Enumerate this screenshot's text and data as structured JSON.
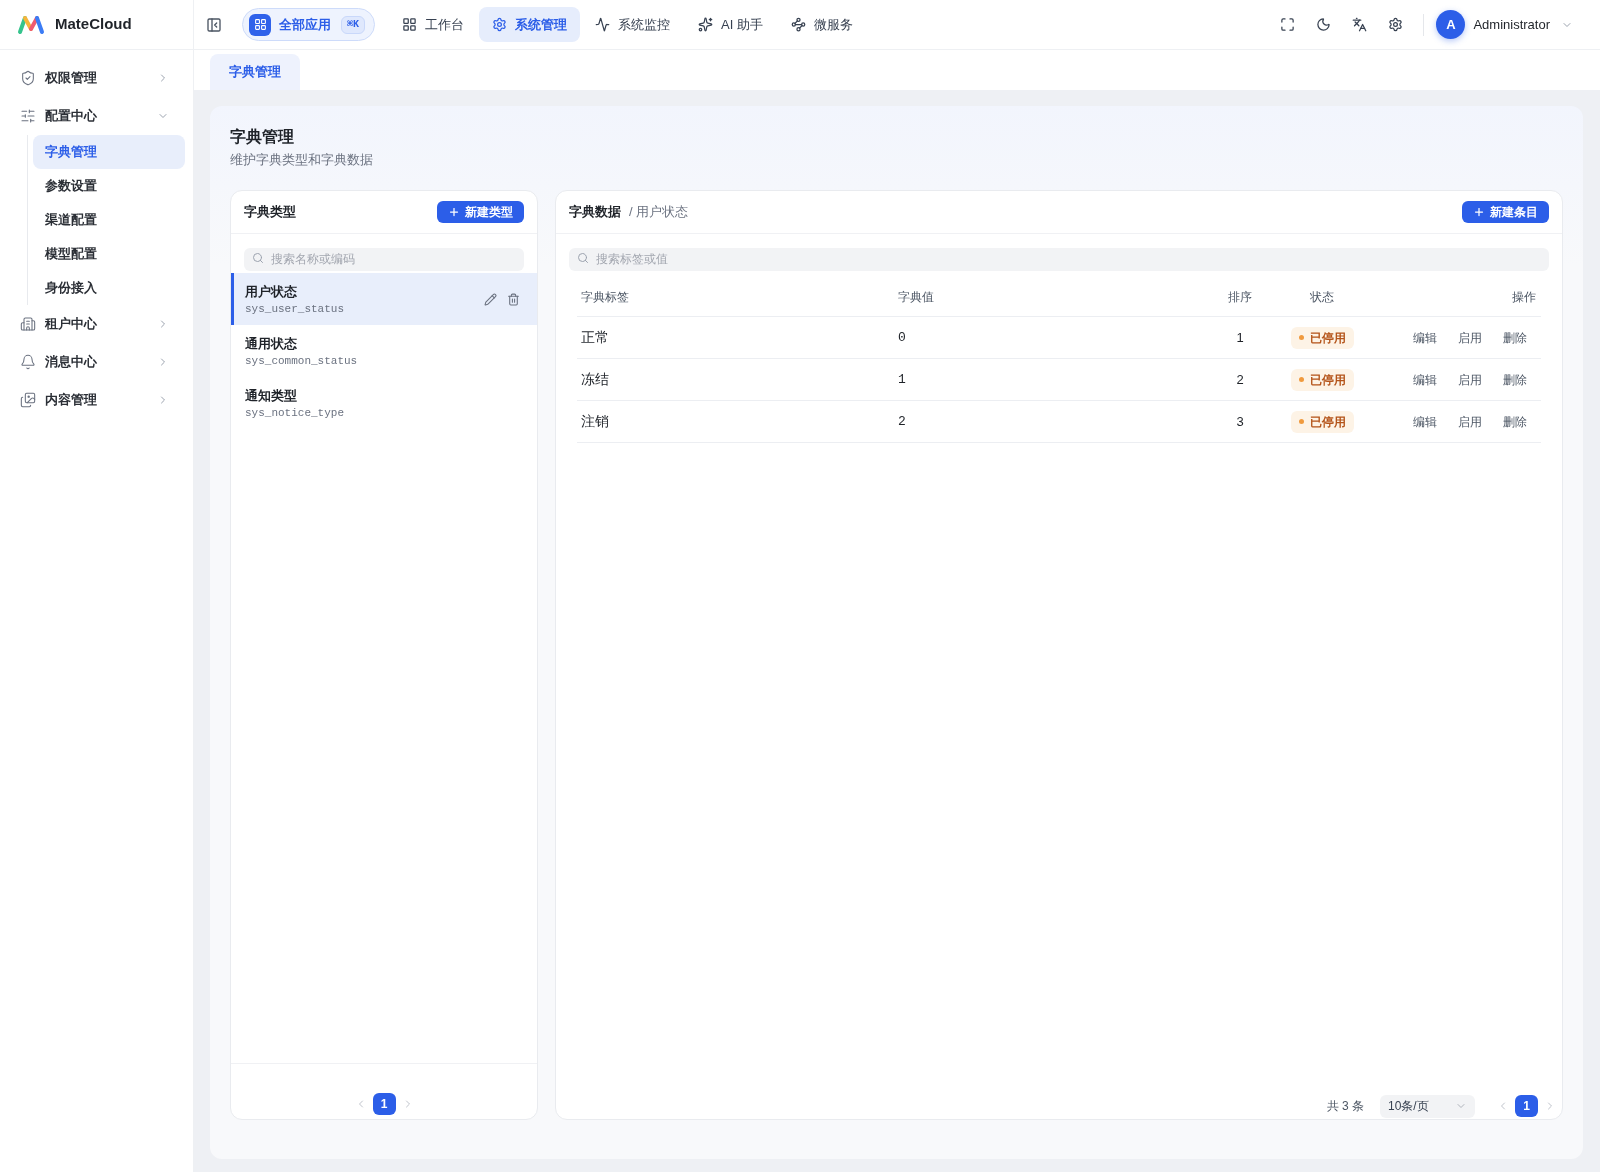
{
  "app": {
    "name": "MateCloud"
  },
  "topbar": {
    "all_apps": {
      "label": "全部应用",
      "shortcut": "⌘K"
    },
    "nav": [
      {
        "label": "工作台",
        "selected": false
      },
      {
        "label": "系统管理",
        "selected": true
      },
      {
        "label": "系统监控",
        "selected": false
      },
      {
        "label": "AI 助手",
        "selected": false
      },
      {
        "label": "微服务",
        "selected": false
      }
    ],
    "user": {
      "initial": "A",
      "name": "Administrator"
    }
  },
  "sidebar": {
    "items": [
      {
        "label": "权限管理",
        "expanded": false
      },
      {
        "label": "配置中心",
        "expanded": true,
        "children": [
          {
            "label": "字典管理",
            "selected": true
          },
          {
            "label": "参数设置",
            "selected": false
          },
          {
            "label": "渠道配置",
            "selected": false
          },
          {
            "label": "模型配置",
            "selected": false
          },
          {
            "label": "身份接入",
            "selected": false
          }
        ]
      },
      {
        "label": "租户中心",
        "expanded": false
      },
      {
        "label": "消息中心",
        "expanded": false
      },
      {
        "label": "内容管理",
        "expanded": false
      }
    ]
  },
  "tabs": [
    {
      "label": "字典管理",
      "selected": true
    }
  ],
  "page": {
    "title": "字典管理",
    "subtitle": "维护字典类型和字典数据"
  },
  "types_panel": {
    "title": "字典类型",
    "add_button": "新建类型",
    "search": {
      "placeholder": "搜索名称或编码"
    },
    "items": [
      {
        "name": "用户状态",
        "code": "sys_user_status",
        "selected": true
      },
      {
        "name": "通用状态",
        "code": "sys_common_status",
        "selected": false
      },
      {
        "name": "通知类型",
        "code": "sys_notice_type",
        "selected": false
      }
    ],
    "pages": [
      {
        "label": "1",
        "selected": true
      }
    ]
  },
  "data_panel": {
    "title": "字典数据",
    "context": "/ 用户状态",
    "add_button": "新建条目",
    "search": {
      "placeholder": "搜索标签或值"
    },
    "table": {
      "columns": [
        "字典标签",
        "字典值",
        "排序",
        "状态",
        "操作"
      ],
      "rows": [
        {
          "label": "正常",
          "value": "0",
          "sort": "1",
          "status": {
            "label": "已停用",
            "enabled": false
          },
          "actions": [
            "编辑",
            "启用",
            "删除"
          ]
        },
        {
          "label": "冻结",
          "value": "1",
          "sort": "2",
          "status": {
            "label": "已停用",
            "enabled": false
          },
          "actions": [
            "编辑",
            "启用",
            "删除"
          ]
        },
        {
          "label": "注销",
          "value": "2",
          "sort": "3",
          "status": {
            "label": "已停用",
            "enabled": false
          },
          "actions": [
            "编辑",
            "启用",
            "删除"
          ]
        }
      ]
    },
    "footer": {
      "total": "共 3 条",
      "page_size": "10条/页",
      "pages": [
        {
          "label": "1",
          "selected": true
        }
      ]
    }
  }
}
